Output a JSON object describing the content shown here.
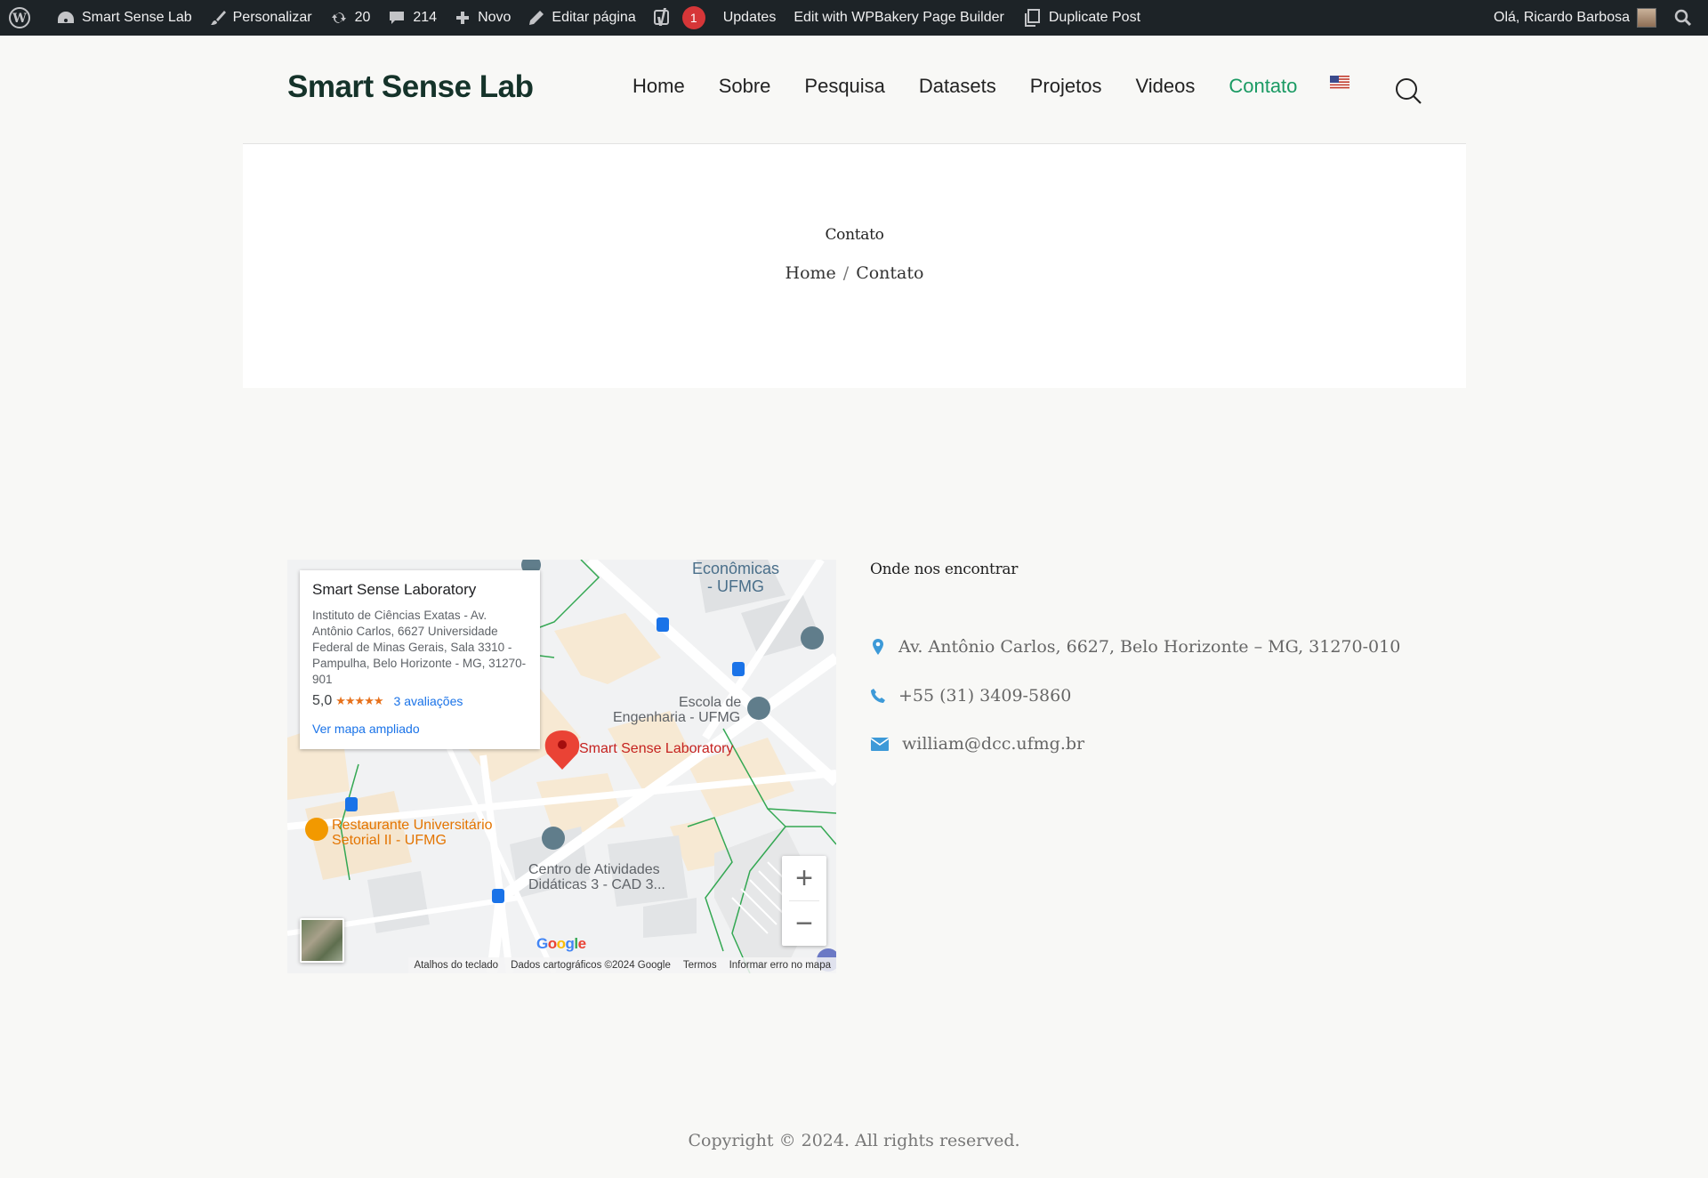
{
  "adminbar": {
    "site_name": "Smart Sense Lab",
    "customize": "Personalizar",
    "updates_count": "20",
    "comments_count": "214",
    "new": "Novo",
    "edit_page": "Editar página",
    "yoast_badge": "1",
    "updates": "Updates",
    "wpbakery": "Edit with WPBakery Page Builder",
    "duplicate": "Duplicate Post",
    "greeting": "Olá, Ricardo Barbosa"
  },
  "header": {
    "logo": "Smart Sense Lab",
    "nav": [
      {
        "label": "Home"
      },
      {
        "label": "Sobre"
      },
      {
        "label": "Pesquisa"
      },
      {
        "label": "Datasets"
      },
      {
        "label": "Projetos"
      },
      {
        "label": "Videos"
      },
      {
        "label": "Contato",
        "active": true
      }
    ],
    "language_icon": "us-flag-icon",
    "search_icon": "search-icon"
  },
  "page": {
    "title": "Contato",
    "breadcrumb": {
      "home": "Home",
      "separator": "/",
      "current": "Contato"
    }
  },
  "map": {
    "card": {
      "title": "Smart Sense Laboratory",
      "address": "Instituto de Ciências Exatas - Av. Antônio Carlos, 6627 Universidade Federal de Minas Gerais, Sala 3310 - Pampulha, Belo Horizonte - MG, 31270-901",
      "rating": "5,0",
      "stars": "★★★★★",
      "reviews": "3 avaliações",
      "larger_map": "Ver mapa ampliado"
    },
    "labels": {
      "economicas": "Econômicas\n- UFMG",
      "escola_1": "Escola de",
      "escola_2": "Engenharia - UFMG",
      "pin_label": "Smart Sense Laboratory",
      "restaurante_1": "Restaurante Universitário",
      "restaurante_2": "Setorial II - UFMG",
      "cad_1": "Centro de Atividades",
      "cad_2": "Didáticas 3 -  CAD 3..."
    },
    "zoom_in": "+",
    "zoom_out": "−",
    "google": "Google",
    "footer": {
      "shortcuts": "Atalhos do teclado",
      "data": "Dados cartográficos ©2024 Google",
      "terms": "Termos",
      "report": "Informar erro no mapa"
    }
  },
  "contact": {
    "heading": "Onde nos encontrar",
    "address": "Av. Antônio Carlos, 6627, Belo Horizonte – MG, 31270-010",
    "phone": "+55 (31) 3409-5860",
    "email": "william@dcc.ufmg.br",
    "accent_color": "#3d9ad8"
  },
  "footer": {
    "copyright": "Copyright © 2024. All rights reserved."
  }
}
